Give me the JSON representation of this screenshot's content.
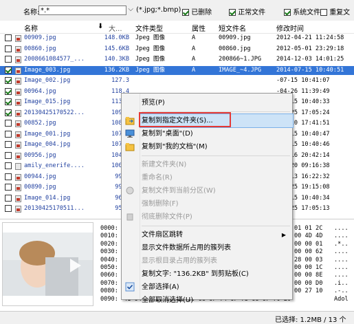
{
  "filter": {
    "name_label": "名称:",
    "name_value": "*.*",
    "ext_value": "(*.jpg;*.bmp)",
    "checks": [
      {
        "label": "已删除",
        "checked": true
      },
      {
        "label": "正常文件",
        "checked": true
      },
      {
        "label": "系统文件",
        "checked": true
      },
      {
        "label": "重复文",
        "checked": false
      }
    ]
  },
  "columns": {
    "name": "名称",
    "size": "大...",
    "type": "文件类型",
    "attr": "属性",
    "short": "短文件名",
    "mtime": "修改时间"
  },
  "rows": [
    {
      "checked": false,
      "icon": "img",
      "name": "00909.jpg",
      "size": "148.0KB",
      "type": "Jpeg 图像",
      "attr": "A",
      "short": "00909.jpg",
      "mtime": "2012-04-21 11:24:58",
      "selected": false
    },
    {
      "checked": false,
      "icon": "img",
      "name": "00860.jpg",
      "size": "145.6KB",
      "type": "Jpeg 图像",
      "attr": "A",
      "short": "00860.jpg",
      "mtime": "2012-05-01 23:29:18",
      "selected": false
    },
    {
      "checked": false,
      "icon": "img",
      "name": "2008661084577_...",
      "size": "140.3KB",
      "type": "Jpeg 图像",
      "attr": "A",
      "short": "200866~1.JPG",
      "mtime": "2014-12-03 14:01:25",
      "selected": false
    },
    {
      "checked": true,
      "icon": "img",
      "name": "Image_003.jpg",
      "size": "136.2KB",
      "type": "Jpeg 图像",
      "attr": "A",
      "short": "IMAGE_~4.JPG",
      "mtime": "2014-07-15 10:40:51",
      "selected": true
    },
    {
      "checked": true,
      "icon": "img",
      "name": "Image_002.jpg",
      "size": "127.3",
      "type": "",
      "attr": "",
      "short": "",
      "mtime": "-07-15 10:41:07",
      "selected": false
    },
    {
      "checked": true,
      "icon": "img",
      "name": "00964.jpg",
      "size": "118.4",
      "type": "",
      "attr": "",
      "short": "",
      "mtime": "-04-26 11:39:49",
      "selected": false
    },
    {
      "checked": true,
      "icon": "img",
      "name": "Image_015.jpg",
      "size": "113.9",
      "type": "",
      "attr": "",
      "short": "",
      "mtime": "-07-15 10:40:33",
      "selected": false
    },
    {
      "checked": true,
      "icon": "img",
      "name": "20130425170522...",
      "size": "109.1",
      "type": "",
      "attr": "",
      "short": "",
      "mtime": "-04-25 17:05:24",
      "selected": false
    },
    {
      "checked": false,
      "icon": "img",
      "name": "00852.jpg",
      "size": "108.6",
      "type": "",
      "attr": "",
      "short": "",
      "mtime": "-04-10 17:41:51",
      "selected": false
    },
    {
      "checked": false,
      "icon": "img",
      "name": "Image_001.jpg",
      "size": "107.7",
      "type": "",
      "attr": "",
      "short": "",
      "mtime": "-07-15 10:40:47",
      "selected": false
    },
    {
      "checked": false,
      "icon": "img",
      "name": "Image_004.jpg",
      "size": "107.1",
      "type": "",
      "attr": "",
      "short": "",
      "mtime": "-07-15 10:40:46",
      "selected": false
    },
    {
      "checked": false,
      "icon": "img",
      "name": "00956.jpg",
      "size": "104.8",
      "type": "",
      "attr": "",
      "short": "",
      "mtime": "-05-16 20:42:14",
      "selected": false
    },
    {
      "checked": false,
      "icon": "blank",
      "name": "amily_enerife....",
      "size": "100.4",
      "type": "",
      "attr": "",
      "short": "",
      "mtime": "-03-20 09:16:38",
      "selected": false
    },
    {
      "checked": false,
      "icon": "img",
      "name": "00944.jpg",
      "size": "99.5",
      "type": "",
      "attr": "",
      "short": "",
      "mtime": "-12-13 16:22:32",
      "selected": false
    },
    {
      "checked": false,
      "icon": "img",
      "name": "00890.jpg",
      "size": "99.0",
      "type": "",
      "attr": "",
      "short": "",
      "mtime": "-03-25 19:15:08",
      "selected": false
    },
    {
      "checked": false,
      "icon": "img",
      "name": "Image_014.jpg",
      "size": "96.2",
      "type": "",
      "attr": "",
      "short": "",
      "mtime": "-07-15 10:40:34",
      "selected": false
    },
    {
      "checked": false,
      "icon": "img",
      "name": "20130425170511...",
      "size": "95.3",
      "type": "",
      "attr": "",
      "short": "",
      "mtime": "-04-25 17:05:13",
      "selected": false
    }
  ],
  "hex": {
    "offsets": [
      "0000:",
      "0010:",
      "0020:",
      "0030:",
      "0040:",
      "0050:",
      "0060:",
      "0070:",
      "0080:",
      "0090:"
    ],
    "right_rows": [
      "01 01 2C",
      "00 4D 4D",
      "00 00 01",
      "00 00 62",
      "28 00 03",
      "00 00 1C",
      "00 00 8E",
      "00 00 D0",
      "00 27 10",
      "6F 70 20"
    ],
    "ascii_rows": [
      "....",
      "....",
      ".*..",
      "....",
      "....",
      "....",
      "....",
      ".i..",
      ".-..",
      "Adol"
    ],
    "last_row": "41 64 6F 62 65 20 50 68 6F 74 6F 73 68 6F 70 20"
  },
  "menu": {
    "items": [
      {
        "label": "预览(P)",
        "disabled": false,
        "icon": "",
        "highlight": false
      },
      {
        "sep": true
      },
      {
        "label": "复制到指定文件夹(S)...",
        "disabled": false,
        "icon": "copy-folder-icon",
        "highlight": true
      },
      {
        "label": "复制到\"桌面\"(D)",
        "disabled": false,
        "icon": "desktop-icon",
        "highlight": false
      },
      {
        "label": "复制到\"我的文档\"(M)",
        "disabled": false,
        "icon": "folder-icon",
        "highlight": false
      },
      {
        "sep": true
      },
      {
        "label": "新建文件夹(N)",
        "disabled": true,
        "icon": "",
        "highlight": false
      },
      {
        "label": "重命名(R)",
        "disabled": true,
        "icon": "",
        "highlight": false
      },
      {
        "label": "复制文件到当前分区(W)",
        "disabled": true,
        "icon": "copy-disk-icon",
        "highlight": false
      },
      {
        "label": "强制删除(F)",
        "disabled": true,
        "icon": "",
        "highlight": false
      },
      {
        "label": "彻底删除文件(P)",
        "disabled": true,
        "icon": "delete-icon",
        "highlight": false
      },
      {
        "sep": true
      },
      {
        "label": "文件扇区跳转",
        "disabled": false,
        "icon": "",
        "highlight": false,
        "submenu": true
      },
      {
        "label": "显示文件数据所占用的簇列表",
        "disabled": false,
        "icon": "",
        "highlight": false
      },
      {
        "label": "显示根目录占用的簇列表",
        "disabled": true,
        "icon": "",
        "highlight": false
      },
      {
        "label": "复制文字: \"136.2KB\" 到剪贴板(C)",
        "disabled": false,
        "icon": "",
        "highlight": false
      },
      {
        "label": "全部选择(A)",
        "disabled": false,
        "icon": "check-icon",
        "highlight": false
      },
      {
        "label": "全部取消选择(U)",
        "disabled": false,
        "icon": "",
        "highlight": false
      }
    ]
  },
  "status": {
    "text": "已选择: 1.2MB / 13 个"
  },
  "colors": {
    "selection": "#3375d7",
    "highlight_border": "#e53935"
  }
}
